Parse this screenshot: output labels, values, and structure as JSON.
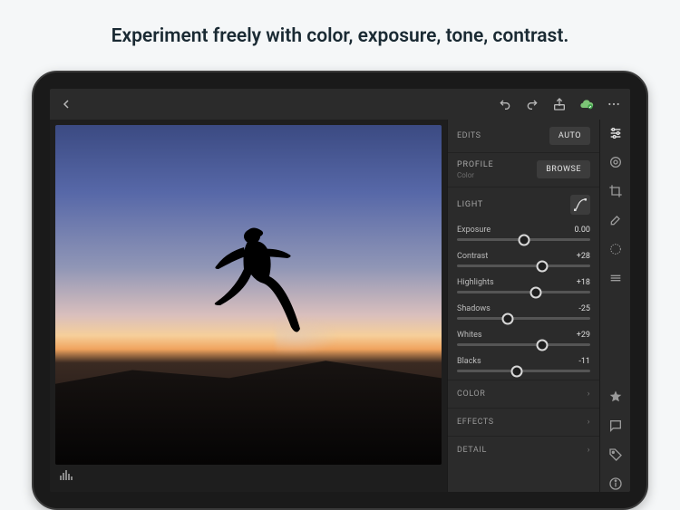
{
  "headline": "Experiment freely with color, exposure, tone, contrast.",
  "topbar": {
    "back_icon": "chevron-left",
    "undo_icon": "undo",
    "redo_icon": "redo",
    "share_icon": "share",
    "cloud_icon": "cloud-synced",
    "more_icon": "more"
  },
  "panel": {
    "edits_label": "EDITS",
    "auto_label": "AUTO",
    "profile_label": "PROFILE",
    "profile_value": "Color",
    "browse_label": "BROWSE",
    "light_label": "LIGHT",
    "sliders": [
      {
        "name": "Exposure",
        "value": "0.00",
        "pos": 50
      },
      {
        "name": "Contrast",
        "value": "+28",
        "pos": 64
      },
      {
        "name": "Highlights",
        "value": "+18",
        "pos": 59
      },
      {
        "name": "Shadows",
        "value": "-25",
        "pos": 38
      },
      {
        "name": "Whites",
        "value": "+29",
        "pos": 64
      },
      {
        "name": "Blacks",
        "value": "-11",
        "pos": 45
      }
    ],
    "color_label": "COLOR",
    "effects_label": "EFFECTS",
    "detail_label": "DETAIL"
  },
  "rail": {
    "items": [
      "sliders",
      "target",
      "crop",
      "brush",
      "radial",
      "gradient"
    ],
    "bottom": [
      "star",
      "comment",
      "tag",
      "info"
    ]
  }
}
